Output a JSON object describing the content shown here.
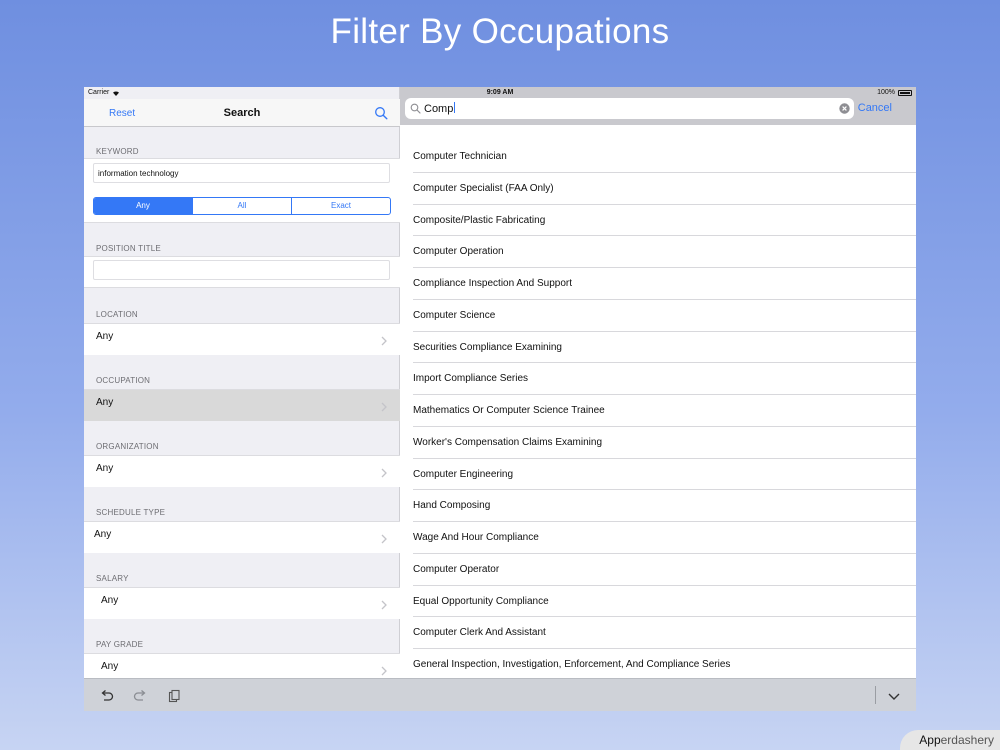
{
  "banner": {
    "title": "Filter By Occupations"
  },
  "status_bar": {
    "carrier": "Carrier",
    "time": "9:09 AM",
    "battery": "100%"
  },
  "left_nav": {
    "reset_label": "Reset",
    "title": "Search"
  },
  "keyword": {
    "label": "KEYWORD",
    "value": "information technology",
    "segments": [
      "Any",
      "All",
      "Exact"
    ],
    "selected_segment": "Any"
  },
  "position_title": {
    "label": "POSITION TITLE",
    "value": ""
  },
  "filters": [
    {
      "label": "LOCATION",
      "value": "Any"
    },
    {
      "label": "OCCUPATION",
      "value": "Any",
      "selected": true
    },
    {
      "label": "ORGANIZATION",
      "value": "Any"
    },
    {
      "label": "SCHEDULE TYPE",
      "value": "Any"
    },
    {
      "label": "SALARY",
      "value": "Any"
    },
    {
      "label": "PAY GRADE",
      "value": "Any"
    }
  ],
  "search": {
    "query": "Comp",
    "cancel_label": "Cancel"
  },
  "results": [
    "Computer Technician",
    "Computer Specialist (FAA Only)",
    "Composite/Plastic Fabricating",
    "Computer Operation",
    "Compliance Inspection And Support",
    "Computer Science",
    "Securities Compliance Examining",
    "Import Compliance Series",
    "Mathematics Or Computer Science Trainee",
    "Worker's Compensation Claims Examining",
    "Computer Engineering",
    "Hand Composing",
    "Wage And Hour Compliance",
    "Computer Operator",
    "Equal Opportunity Compliance",
    "Computer Clerk And Assistant",
    "General Inspection, Investigation, Enforcement, And Compliance Series"
  ],
  "toolbar_icons": [
    "undo-icon",
    "redo-icon",
    "paste-icon",
    "chevron-down-icon"
  ],
  "watermark": {
    "bold": "App",
    "light": "erdashery"
  },
  "colors": {
    "accent": "#3478f6",
    "background_top": "#6f8fe0",
    "selected_row": "#d9d9d9"
  }
}
